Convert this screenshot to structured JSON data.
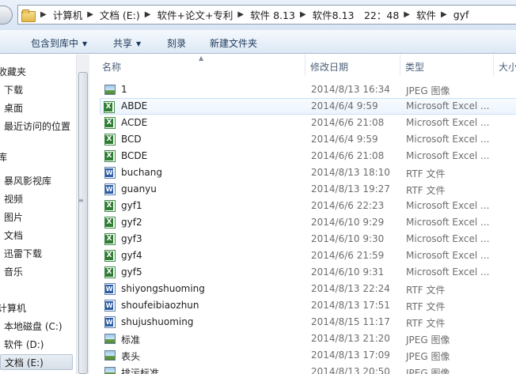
{
  "address": {
    "crumbs": [
      "计算机",
      "文档 (E:)",
      "软件+论文+专利",
      "软件 8.13",
      "软件8.13　22：48",
      "软件",
      "gyf"
    ]
  },
  "toolbar": {
    "include_library": "包含到库中",
    "share": "共享",
    "burn": "刻录",
    "new_folder": "新建文件夹"
  },
  "nav": {
    "items": [
      {
        "label": "收藏夹",
        "group": true
      },
      {
        "label": "下载"
      },
      {
        "label": "桌面"
      },
      {
        "label": "最近访问的位置"
      },
      {
        "label": "库",
        "group": true
      },
      {
        "label": "暴风影视库"
      },
      {
        "label": "视频"
      },
      {
        "label": "图片"
      },
      {
        "label": "文档"
      },
      {
        "label": "迅雷下载"
      },
      {
        "label": "音乐"
      },
      {
        "label": "计算机",
        "group": true
      },
      {
        "label": "本地磁盘 (C:)"
      },
      {
        "label": "软件 (D:)"
      },
      {
        "label": "文档 (E:)",
        "selected": true
      }
    ]
  },
  "columns": {
    "name": "名称",
    "date": "修改日期",
    "type": "类型",
    "size": "大小"
  },
  "files": [
    {
      "name": "1",
      "date": "2014/8/13 16:34",
      "type": "JPEG 图像",
      "icon": "jpeg-icon"
    },
    {
      "name": "ABDE",
      "date": "2014/6/4 9:59",
      "type": "Microsoft Excel ...",
      "icon": "excel-icon",
      "hover": true
    },
    {
      "name": "ACDE",
      "date": "2014/6/6 21:08",
      "type": "Microsoft Excel ...",
      "icon": "excel-icon"
    },
    {
      "name": "BCD",
      "date": "2014/6/4 9:59",
      "type": "Microsoft Excel ...",
      "icon": "excel-icon"
    },
    {
      "name": "BCDE",
      "date": "2014/6/6 21:08",
      "type": "Microsoft Excel ...",
      "icon": "excel-icon"
    },
    {
      "name": "buchang",
      "date": "2014/8/13 18:10",
      "type": "RTF 文件",
      "icon": "rtf-icon"
    },
    {
      "name": "guanyu",
      "date": "2014/8/13 19:27",
      "type": "RTF 文件",
      "icon": "rtf-icon"
    },
    {
      "name": "gyf1",
      "date": "2014/6/6 22:23",
      "type": "Microsoft Excel ...",
      "icon": "excel-icon"
    },
    {
      "name": "gyf2",
      "date": "2014/6/10 9:29",
      "type": "Microsoft Excel ...",
      "icon": "excel-icon"
    },
    {
      "name": "gyf3",
      "date": "2014/6/10 9:30",
      "type": "Microsoft Excel ...",
      "icon": "excel-icon"
    },
    {
      "name": "gyf4",
      "date": "2014/6/6 21:59",
      "type": "Microsoft Excel ...",
      "icon": "excel-icon"
    },
    {
      "name": "gyf5",
      "date": "2014/6/10 9:31",
      "type": "Microsoft Excel ...",
      "icon": "excel-icon"
    },
    {
      "name": "shiyongshuoming",
      "date": "2014/8/13 22:24",
      "type": "RTF 文件",
      "icon": "rtf-icon"
    },
    {
      "name": "shoufeibiaozhun",
      "date": "2014/8/13 17:51",
      "type": "RTF 文件",
      "icon": "rtf-icon"
    },
    {
      "name": "shujushuoming",
      "date": "2014/8/15 11:17",
      "type": "RTF 文件",
      "icon": "rtf-icon"
    },
    {
      "name": "标准",
      "date": "2014/8/13 21:20",
      "type": "JPEG 图像",
      "icon": "jpeg-icon"
    },
    {
      "name": "表头",
      "date": "2014/8/13 17:09",
      "type": "JPEG 图像",
      "icon": "jpeg-icon"
    },
    {
      "name": "排污标准",
      "date": "2014/8/13 20:50",
      "type": "JPEG 图像",
      "icon": "jpeg-icon"
    }
  ]
}
